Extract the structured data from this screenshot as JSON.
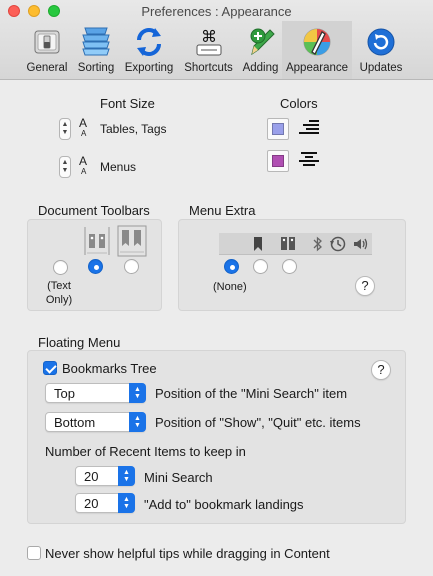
{
  "window": {
    "title": "Preferences : Appearance"
  },
  "toolbar": {
    "items": [
      {
        "label": "General",
        "icon": "switch-icon"
      },
      {
        "label": "Sorting",
        "icon": "sorting-stack-icon"
      },
      {
        "label": "Exporting",
        "icon": "refresh-arrows-icon"
      },
      {
        "label": "Shortcuts",
        "icon": "command-key-icon"
      },
      {
        "label": "Adding",
        "icon": "add-pencil-icon"
      },
      {
        "label": "Appearance",
        "icon": "color-palette-icon"
      },
      {
        "label": "Updates",
        "icon": "update-icon"
      }
    ],
    "selected": "Appearance"
  },
  "font_size": {
    "title": "Font Size",
    "rows": [
      {
        "label": "Tables, Tags",
        "glyph": "A"
      },
      {
        "label": "Menus",
        "glyph": "A"
      }
    ]
  },
  "colors": {
    "title": "Colors",
    "swatches": [
      {
        "color": "#9aa0ea",
        "name": "tables-tags-color"
      },
      {
        "color": "#b04fb2",
        "name": "menus-color"
      }
    ]
  },
  "document_toolbars": {
    "title": "Document Toolbars",
    "option_none_label": "(Text Only)",
    "selected_index": 1
  },
  "menu_extra": {
    "title": "Menu Extra",
    "option_none_label": "(None)",
    "selected_index": 0,
    "help": "?"
  },
  "floating_menu": {
    "title": "Floating Menu",
    "bookmarks_tree": {
      "label": "Bookmarks Tree",
      "checked": true
    },
    "help": "?",
    "mini_search_position": {
      "value": "Top",
      "label": "Position of the \"Mini Search\" item"
    },
    "show_quit_position": {
      "value": "Bottom",
      "label": "Position of \"Show\", \"Quit\" etc. items"
    },
    "recent_items_heading": "Number of Recent Items to keep in",
    "mini_search_count": {
      "value": "20",
      "label": "Mini Search"
    },
    "add_to_count": {
      "value": "20",
      "label": "\"Add to\" bookmark landings"
    }
  },
  "never_show_tips": {
    "label": "Never show helpful tips while dragging in Content",
    "checked": false
  },
  "accent_color": "#1a73e8"
}
